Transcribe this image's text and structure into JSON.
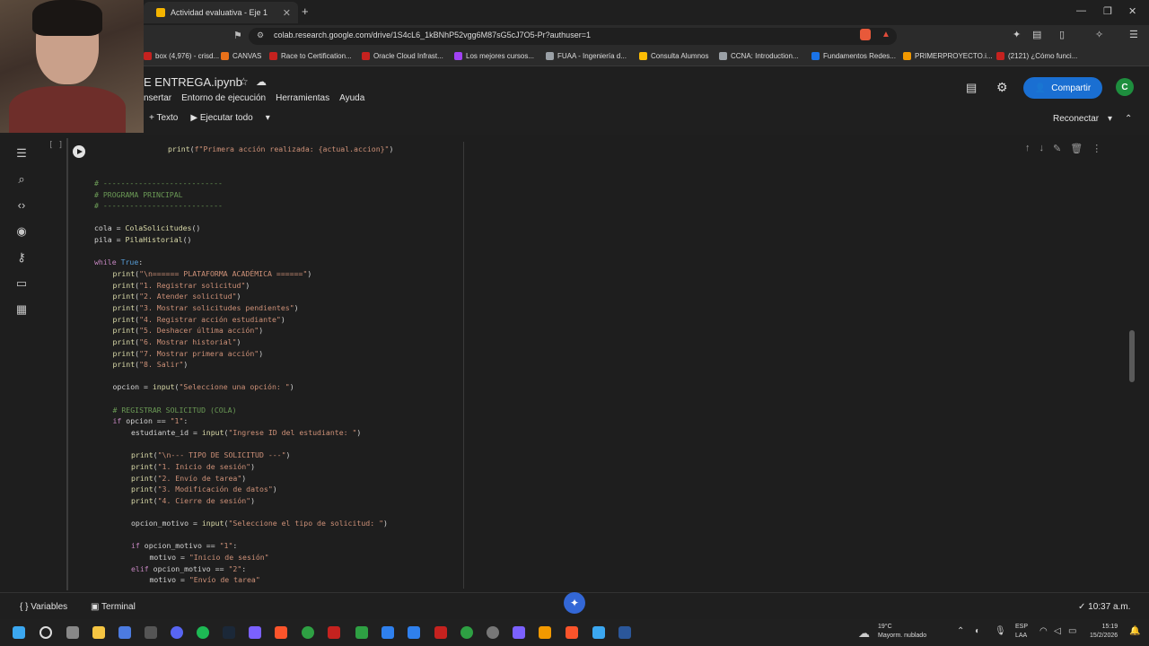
{
  "browser": {
    "tab_title": "Actividad evaluativa - Eje 1",
    "new_tab": "+",
    "url": "colab.research.google.com/drive/1S4cL6_1kBNhP52vgg6M87sG5cJ7O5-Pr?authuser=1",
    "window_controls": [
      "—",
      "❐",
      "✕"
    ],
    "bookmarks": [
      {
        "label": "box (4,976) - crisd...",
        "color": "#c5221f"
      },
      {
        "label": "CANVAS",
        "color": "#e8711a"
      },
      {
        "label": "Race to Certification...",
        "color": "#c5221f"
      },
      {
        "label": "Oracle Cloud Infrast...",
        "color": "#c5221f"
      },
      {
        "label": "Los mejores cursos...",
        "color": "#a142f4"
      },
      {
        "label": "FUAA - Ingeniería d...",
        "color": "#9aa0a6"
      },
      {
        "label": "Consulta Alumnos",
        "color": "#fbbc04"
      },
      {
        "label": "CCNA: Introduction...",
        "color": "#9aa0a6"
      },
      {
        "label": "Fundamentos Redes...",
        "color": "#1a73e8"
      },
      {
        "label": "PRIMERPROYECTO.i...",
        "color": "#f29900"
      },
      {
        "label": "(2121) ¿Cómo funci...",
        "color": "#c5221f"
      }
    ]
  },
  "colab": {
    "notebook_title": "E ENTREGA.ipynb",
    "menus": [
      "nsertar",
      "Entorno de ejecución",
      "Herramientas",
      "Ayuda"
    ],
    "toolbar": {
      "add_text": "+ Texto",
      "run_all": "▶ Ejecutar todo"
    },
    "share_label": "Compartir",
    "avatar_letter": "C",
    "reconnect_label": "Reconectar",
    "cell_bracket": "[ ]"
  },
  "code_lines": [
    {
      "indent": 4,
      "parts": [
        [
          "fn",
          "print"
        ],
        [
          "",
          "("
        ],
        [
          "st",
          "f\"Primera acción realizada: {actual.accion}\""
        ],
        [
          "",
          ")"
        ]
      ]
    },
    {
      "indent": 0,
      "parts": []
    },
    {
      "indent": 0,
      "parts": []
    },
    {
      "indent": 0,
      "parts": [
        [
          "cm",
          "# ---------------------------"
        ]
      ]
    },
    {
      "indent": 0,
      "parts": [
        [
          "cm",
          "# PROGRAMA PRINCIPAL"
        ]
      ]
    },
    {
      "indent": 0,
      "parts": [
        [
          "cm",
          "# ---------------------------"
        ]
      ]
    },
    {
      "indent": 0,
      "parts": []
    },
    {
      "indent": 0,
      "parts": [
        [
          "",
          "cola = "
        ],
        [
          "fn",
          "ColaSolicitudes"
        ],
        [
          "",
          "()"
        ]
      ]
    },
    {
      "indent": 0,
      "parts": [
        [
          "",
          "pila = "
        ],
        [
          "fn",
          "PilaHistorial"
        ],
        [
          "",
          "()"
        ]
      ]
    },
    {
      "indent": 0,
      "parts": []
    },
    {
      "indent": 0,
      "parts": [
        [
          "kw",
          "while "
        ],
        [
          "bi",
          "True"
        ],
        [
          "",
          ":"
        ]
      ]
    },
    {
      "indent": 1,
      "parts": [
        [
          "fn",
          "print"
        ],
        [
          "",
          "("
        ],
        [
          "st",
          "\"\\n====== PLATAFORMA ACADÉMICA ======\""
        ],
        [
          "",
          ")"
        ]
      ]
    },
    {
      "indent": 1,
      "parts": [
        [
          "fn",
          "print"
        ],
        [
          "",
          "("
        ],
        [
          "st",
          "\"1. Registrar solicitud\""
        ],
        [
          "",
          ")"
        ]
      ]
    },
    {
      "indent": 1,
      "parts": [
        [
          "fn",
          "print"
        ],
        [
          "",
          "("
        ],
        [
          "st",
          "\"2. Atender solicitud\""
        ],
        [
          "",
          ")"
        ]
      ]
    },
    {
      "indent": 1,
      "parts": [
        [
          "fn",
          "print"
        ],
        [
          "",
          "("
        ],
        [
          "st",
          "\"3. Mostrar solicitudes pendientes\""
        ],
        [
          "",
          ")"
        ]
      ]
    },
    {
      "indent": 1,
      "parts": [
        [
          "fn",
          "print"
        ],
        [
          "",
          "("
        ],
        [
          "st",
          "\"4. Registrar acción estudiante\""
        ],
        [
          "",
          ")"
        ]
      ]
    },
    {
      "indent": 1,
      "parts": [
        [
          "fn",
          "print"
        ],
        [
          "",
          "("
        ],
        [
          "st",
          "\"5. Deshacer última acción\""
        ],
        [
          "",
          ")"
        ]
      ]
    },
    {
      "indent": 1,
      "parts": [
        [
          "fn",
          "print"
        ],
        [
          "",
          "("
        ],
        [
          "st",
          "\"6. Mostrar historial\""
        ],
        [
          "",
          ")"
        ]
      ]
    },
    {
      "indent": 1,
      "parts": [
        [
          "fn",
          "print"
        ],
        [
          "",
          "("
        ],
        [
          "st",
          "\"7. Mostrar primera acción\""
        ],
        [
          "",
          ")"
        ]
      ]
    },
    {
      "indent": 1,
      "parts": [
        [
          "fn",
          "print"
        ],
        [
          "",
          "("
        ],
        [
          "st",
          "\"8. Salir\""
        ],
        [
          "",
          ")"
        ]
      ]
    },
    {
      "indent": 0,
      "parts": []
    },
    {
      "indent": 1,
      "parts": [
        [
          "",
          "opcion = "
        ],
        [
          "fn",
          "input"
        ],
        [
          "",
          "("
        ],
        [
          "st",
          "\"Seleccione una opción: \""
        ],
        [
          "",
          ")"
        ]
      ]
    },
    {
      "indent": 0,
      "parts": []
    },
    {
      "indent": 1,
      "parts": [
        [
          "cm",
          "# REGISTRAR SOLICITUD (COLA)"
        ]
      ]
    },
    {
      "indent": 1,
      "parts": [
        [
          "kw",
          "if "
        ],
        [
          "",
          "opcion == "
        ],
        [
          "st",
          "\"1\""
        ],
        [
          "",
          ":"
        ]
      ]
    },
    {
      "indent": 2,
      "parts": [
        [
          "",
          "estudiante_id = "
        ],
        [
          "fn",
          "input"
        ],
        [
          "",
          "("
        ],
        [
          "st",
          "\"Ingrese ID del estudiante: \""
        ],
        [
          "",
          ")"
        ]
      ]
    },
    {
      "indent": 0,
      "parts": []
    },
    {
      "indent": 2,
      "parts": [
        [
          "fn",
          "print"
        ],
        [
          "",
          "("
        ],
        [
          "st",
          "\"\\n--- TIPO DE SOLICITUD ---\""
        ],
        [
          "",
          ")"
        ]
      ]
    },
    {
      "indent": 2,
      "parts": [
        [
          "fn",
          "print"
        ],
        [
          "",
          "("
        ],
        [
          "st",
          "\"1. Inicio de sesión\""
        ],
        [
          "",
          ")"
        ]
      ]
    },
    {
      "indent": 2,
      "parts": [
        [
          "fn",
          "print"
        ],
        [
          "",
          "("
        ],
        [
          "st",
          "\"2. Envío de tarea\""
        ],
        [
          "",
          ")"
        ]
      ]
    },
    {
      "indent": 2,
      "parts": [
        [
          "fn",
          "print"
        ],
        [
          "",
          "("
        ],
        [
          "st",
          "\"3. Modificación de datos\""
        ],
        [
          "",
          ")"
        ]
      ]
    },
    {
      "indent": 2,
      "parts": [
        [
          "fn",
          "print"
        ],
        [
          "",
          "("
        ],
        [
          "st",
          "\"4. Cierre de sesión\""
        ],
        [
          "",
          ")"
        ]
      ]
    },
    {
      "indent": 0,
      "parts": []
    },
    {
      "indent": 2,
      "parts": [
        [
          "",
          "opcion_motivo = "
        ],
        [
          "fn",
          "input"
        ],
        [
          "",
          "("
        ],
        [
          "st",
          "\"Seleccione el tipo de solicitud: \""
        ],
        [
          "",
          ")"
        ]
      ]
    },
    {
      "indent": 0,
      "parts": []
    },
    {
      "indent": 2,
      "parts": [
        [
          "kw",
          "if "
        ],
        [
          "",
          "opcion_motivo == "
        ],
        [
          "st",
          "\"1\""
        ],
        [
          "",
          ":"
        ]
      ]
    },
    {
      "indent": 3,
      "parts": [
        [
          "",
          "motivo = "
        ],
        [
          "st",
          "\"Inicio de sesión\""
        ]
      ]
    },
    {
      "indent": 2,
      "parts": [
        [
          "kw",
          "elif "
        ],
        [
          "",
          "opcion_motivo == "
        ],
        [
          "st",
          "\"2\""
        ],
        [
          "",
          ":"
        ]
      ]
    },
    {
      "indent": 3,
      "parts": [
        [
          "",
          "motivo = "
        ],
        [
          "st",
          "\"Envío de tarea\""
        ]
      ]
    }
  ],
  "bottom": {
    "variables_label": "{ } Variables",
    "terminal_label": "▣ Terminal",
    "exec_time": "✓ 10:37 a.m."
  },
  "taskbar": {
    "weather_temp": "19°C",
    "weather_desc": "Mayorm. nublado",
    "lang_1": "ESP",
    "lang_2": "LAA",
    "time": "15:19",
    "date": "15/2/2026"
  }
}
